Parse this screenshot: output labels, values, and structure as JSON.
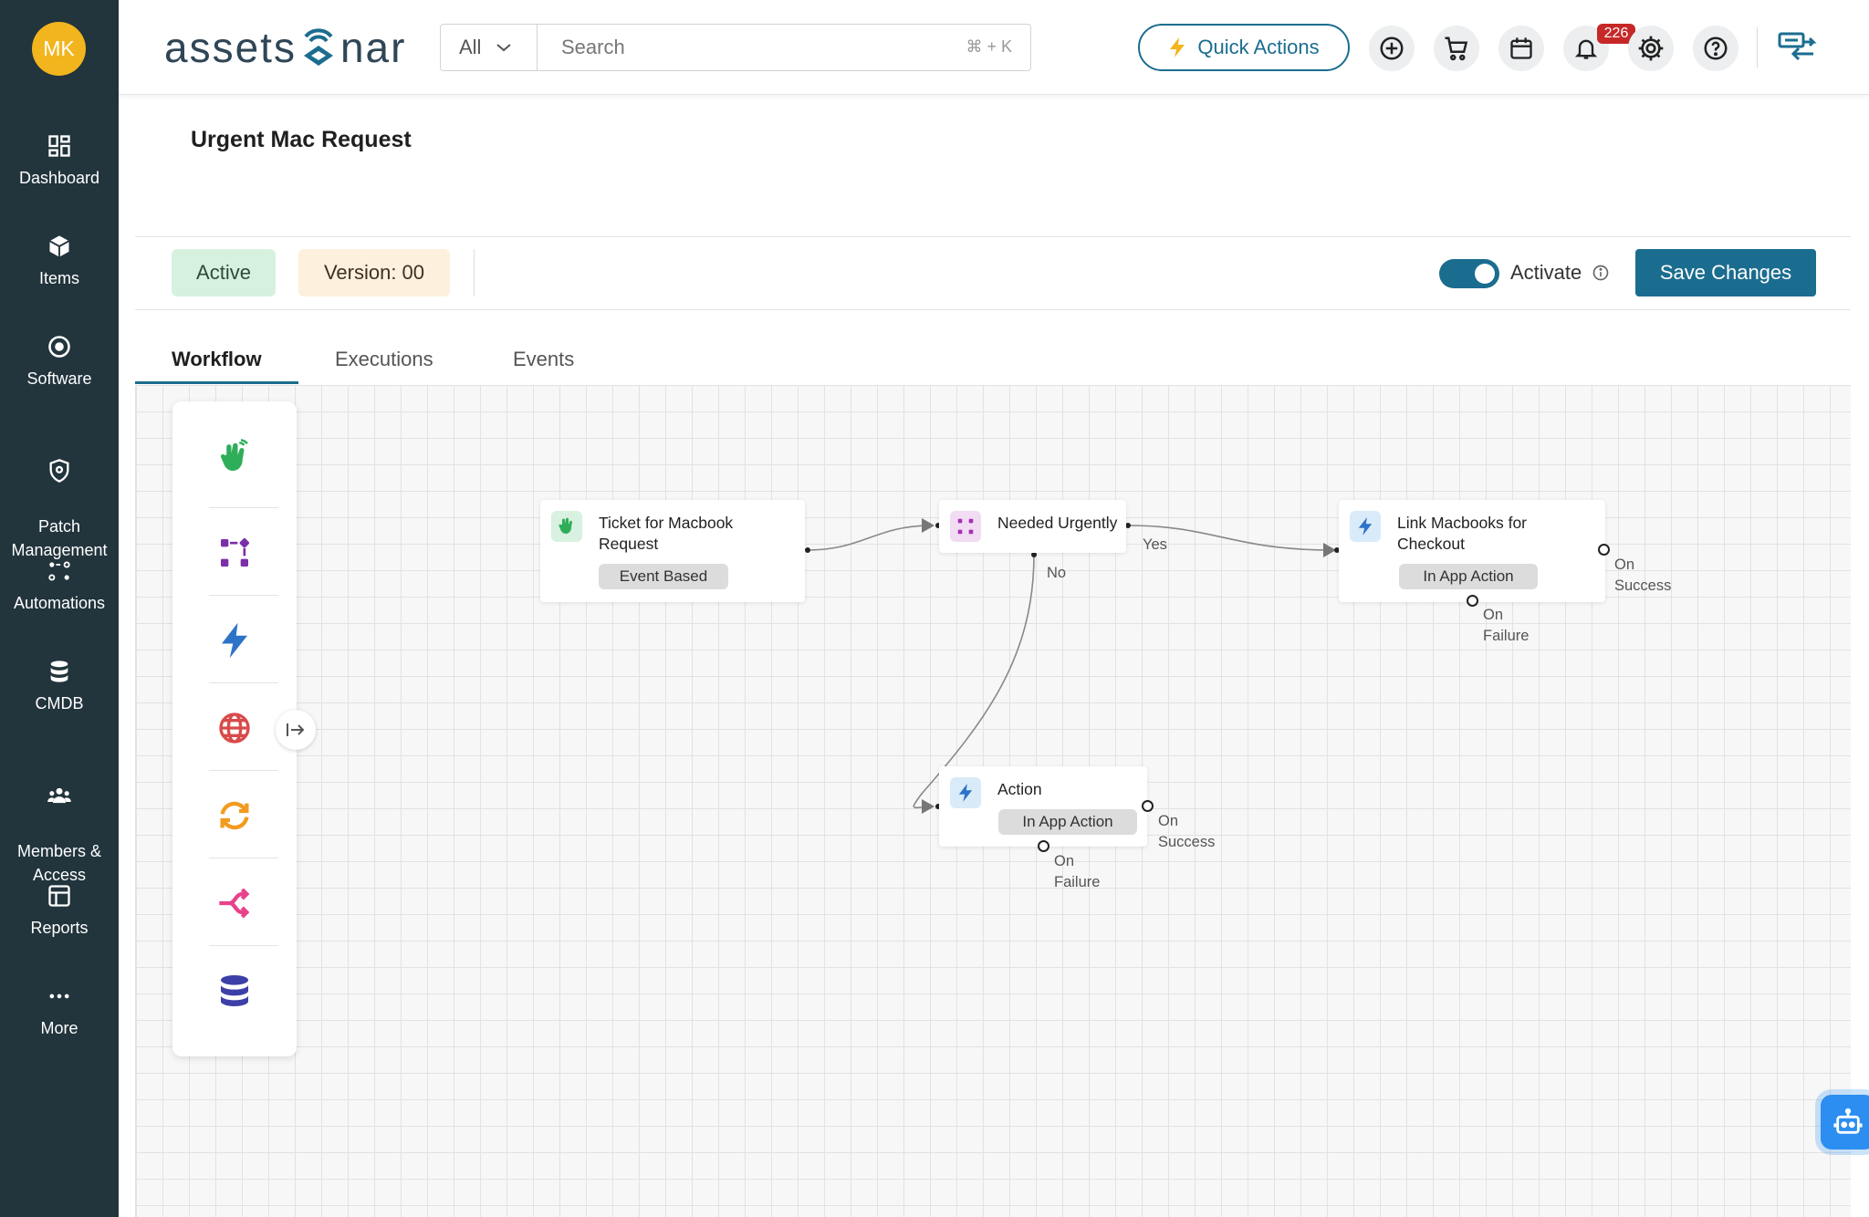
{
  "user": {
    "initials": "MK"
  },
  "sidebar": {
    "items": [
      {
        "label": "Dashboard",
        "icon": "dashboard-icon"
      },
      {
        "label": "Items",
        "icon": "box-icon"
      },
      {
        "label": "Software",
        "icon": "disc-icon"
      },
      {
        "label": "Patch\nManagement",
        "icon": "shield-icon"
      },
      {
        "label": "Automations",
        "icon": "automation-icon"
      },
      {
        "label": "CMDB",
        "icon": "database-icon"
      },
      {
        "label": "Members &\nAccess",
        "icon": "members-icon"
      },
      {
        "label": "Reports",
        "icon": "reports-icon"
      },
      {
        "label": "More",
        "icon": "more-icon"
      }
    ]
  },
  "header": {
    "logo_text_left": "assets",
    "logo_text_right": "nar",
    "search_scope": "All",
    "search_placeholder": "Search",
    "search_shortcut": "⌘ + K",
    "quick_actions_label": "Quick Actions",
    "notification_count": "226"
  },
  "page": {
    "title": "Urgent Mac Request",
    "status": "Active",
    "version": "Version: 00",
    "activate_label": "Activate",
    "activate_on": true,
    "save_label": "Save Changes"
  },
  "tabs": [
    {
      "label": "Workflow",
      "active": true
    },
    {
      "label": "Executions",
      "active": false
    },
    {
      "label": "Events",
      "active": false
    }
  ],
  "workflow": {
    "nodes": {
      "ticket": {
        "title": "Ticket for Macbook\nRequest",
        "tag": "Event Based"
      },
      "condition": {
        "title": "Needed Urgently"
      },
      "link": {
        "title": "Link Macbooks for\nCheckout",
        "tag": "In App Action"
      },
      "action": {
        "title": "Action",
        "tag": "In App Action"
      }
    },
    "labels": {
      "yes": "Yes",
      "no": "No",
      "link_success": "On\nSuccess",
      "link_failure": "On\nFailure",
      "action_success": "On\nSuccess",
      "action_failure": "On\nFailure"
    }
  },
  "colors": {
    "sidebar_bg": "#22343c",
    "accent": "#1b6d8f",
    "avatar": "#f2b51e",
    "badge": "#c62828"
  }
}
